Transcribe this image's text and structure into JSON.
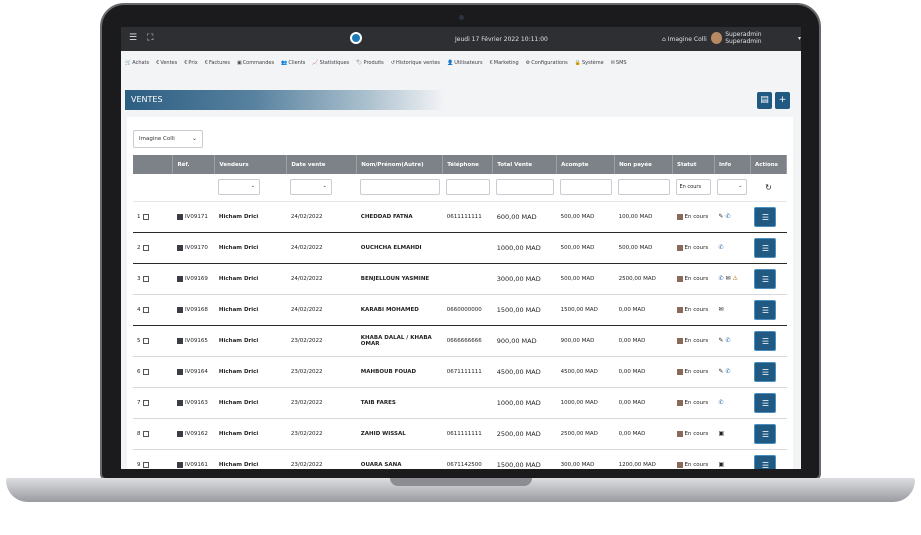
{
  "topbar": {
    "menu_icon": "hamburger-icon",
    "expand_icon": "expand-icon",
    "date": "Jeudi 17 Février 2022 10:11:00",
    "store": "Imagine Colli",
    "user": "Superadmin Superadmin"
  },
  "menu": [
    {
      "icon": "cart-icon",
      "label": "Achats"
    },
    {
      "icon": "euro-icon",
      "label": "Ventes"
    },
    {
      "icon": "euro-icon",
      "label": "Prix"
    },
    {
      "icon": "euro-icon",
      "label": "Factures"
    },
    {
      "icon": "box-icon",
      "label": "Commandes"
    },
    {
      "icon": "users-icon",
      "label": "Clients"
    },
    {
      "icon": "chart-icon",
      "label": "Statistiques"
    },
    {
      "icon": "tag-icon",
      "label": "Produits"
    },
    {
      "icon": "history-icon",
      "label": "Historique ventes"
    },
    {
      "icon": "user-icon",
      "label": "Utilisateurs"
    },
    {
      "icon": "euro-icon",
      "label": "Marketing"
    },
    {
      "icon": "gear-icon",
      "label": "Configurations"
    },
    {
      "icon": "lock-icon",
      "label": "Système"
    },
    {
      "icon": "sms-icon",
      "label": "SMS"
    }
  ],
  "page": {
    "title": "VENTES",
    "save_icon": "save-icon",
    "add_label": "+"
  },
  "store_select": "Imagine Colli",
  "columns": [
    "",
    "Réf.",
    "Vendeurs",
    "Date vente",
    "Nom/Prénom(Autre)",
    "Téléphone",
    "Total Vente",
    "Acompte",
    "Non payée",
    "Statut",
    "Info",
    "Actions"
  ],
  "filters": {
    "status": "En cours"
  },
  "colors": {
    "accent": "#205982",
    "header": "#7d8288",
    "topbar": "#2e2f33"
  },
  "rows": [
    {
      "n": "1",
      "ref": "IV09171",
      "seller": "Hicham Drici",
      "date": "24/02/2022",
      "name": "CHEDDAD FATNA",
      "phone": "0611111111",
      "total": "600,00 MAD",
      "deposit": "500,00 MAD",
      "unpaid": "100,00 MAD",
      "status": "En cours",
      "info": [
        "✎",
        "✆"
      ]
    },
    {
      "n": "2",
      "ref": "IV09170",
      "seller": "Hicham Drici",
      "date": "24/02/2022",
      "name": "OUCHCHA ELMAHDI",
      "phone": "",
      "total": "1000,00 MAD",
      "deposit": "500,00 MAD",
      "unpaid": "500,00 MAD",
      "status": "En cours",
      "info": [
        "✆"
      ]
    },
    {
      "n": "3",
      "ref": "IV09169",
      "seller": "Hicham Drici",
      "date": "24/02/2022",
      "name": "BENJELLOUN YASMINE",
      "phone": "",
      "total": "3000,00 MAD",
      "deposit": "500,00 MAD",
      "unpaid": "2500,00 MAD",
      "status": "En cours",
      "info": [
        "✆",
        "✉",
        "⚠"
      ]
    },
    {
      "n": "4",
      "ref": "IV09168",
      "seller": "Hicham Drici",
      "date": "24/02/2022",
      "name": "KARABI MOHAMED",
      "phone": "0660000000",
      "total": "1500,00 MAD",
      "deposit": "1500,00 MAD",
      "unpaid": "0,00 MAD",
      "status": "En cours",
      "info": [
        "✉"
      ]
    },
    {
      "n": "5",
      "ref": "IV09165",
      "seller": "Hicham Drici",
      "date": "23/02/2022",
      "name": "KHABA DALAL / KHABA OMAR",
      "phone": "0666666666",
      "total": "900,00 MAD",
      "deposit": "900,00 MAD",
      "unpaid": "0,00 MAD",
      "status": "En cours",
      "info": [
        "✎",
        "✆"
      ]
    },
    {
      "n": "6",
      "ref": "IV09164",
      "seller": "Hicham Drici",
      "date": "23/02/2022",
      "name": "MAHBOUB FOUAD",
      "phone": "0671111111",
      "total": "4500,00 MAD",
      "deposit": "4500,00 MAD",
      "unpaid": "0,00 MAD",
      "status": "En cours",
      "info": [
        "✎",
        "✆"
      ]
    },
    {
      "n": "7",
      "ref": "IV09163",
      "seller": "Hicham Drici",
      "date": "23/02/2022",
      "name": "TAIB FARES",
      "phone": "",
      "total": "1000,00 MAD",
      "deposit": "1000,00 MAD",
      "unpaid": "0,00 MAD",
      "status": "En cours",
      "info": [
        "✆"
      ]
    },
    {
      "n": "8",
      "ref": "IV09162",
      "seller": "Hicham Drici",
      "date": "23/02/2022",
      "name": "ZAHID WISSAL",
      "phone": "0611111111",
      "total": "2500,00 MAD",
      "deposit": "2500,00 MAD",
      "unpaid": "0,00 MAD",
      "status": "En cours",
      "info": [
        "▣"
      ]
    },
    {
      "n": "9",
      "ref": "IV09161",
      "seller": "Hicham Drici",
      "date": "23/02/2022",
      "name": "OUARA SANA",
      "phone": "0671142500",
      "total": "1500,00 MAD",
      "deposit": "300,00 MAD",
      "unpaid": "1200,00 MAD",
      "status": "En cours",
      "info": [
        "▣"
      ]
    }
  ]
}
